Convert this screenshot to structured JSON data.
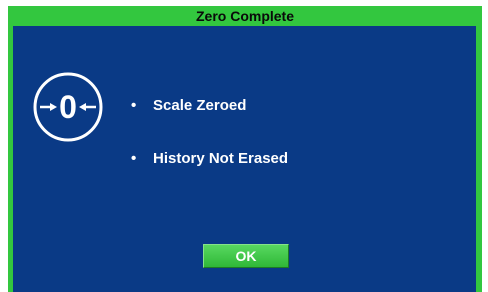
{
  "dialog": {
    "title": "Zero Complete",
    "icon": "zero-scale-icon",
    "icon_text": "0",
    "messages": [
      "Scale Zeroed",
      "History Not Erased"
    ],
    "ok_label": "OK"
  },
  "colors": {
    "frame": "#33c73f",
    "panel": "#0a3a86",
    "text": "#ffffff",
    "button": "#3cc444"
  }
}
